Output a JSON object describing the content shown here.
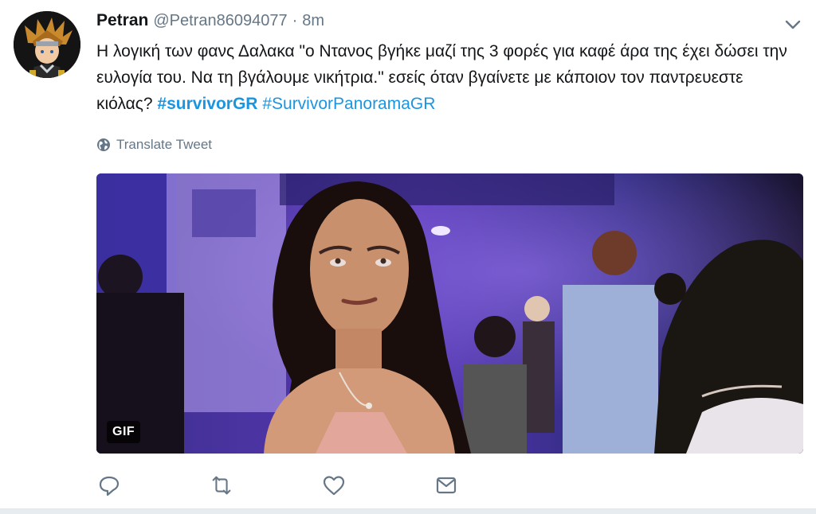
{
  "tweet": {
    "display_name": "Petran",
    "handle": "@Petran86094077",
    "separator": "·",
    "time": "8m",
    "text_plain": "Η λογική των φανς Δαλακα \"ο Ντανος βγήκε μαζί της 3 φορές για καφέ άρα της έχει δώσει την ευλογία του. Να τη βγάλουμε νικήτρια.\" εσείς όταν βγαίνετε με κάποιον τον παντρευεστε κιόλας?",
    "hashtags": [
      "#survivorGR",
      "#SurvivorPanoramaGR"
    ],
    "translate_label": "Translate Tweet",
    "media": {
      "badge": "GIF"
    }
  },
  "icons": {
    "avatar": "avatar-illustration",
    "caret": "chevron-down-icon",
    "translate": "globe-icon",
    "actions": [
      "reply-icon",
      "retweet-icon",
      "like-icon",
      "direct-message-icon"
    ]
  },
  "colors": {
    "link": "#1b95e0",
    "text": "#14171a",
    "secondary": "#657786",
    "background": "#e6ecf0"
  }
}
